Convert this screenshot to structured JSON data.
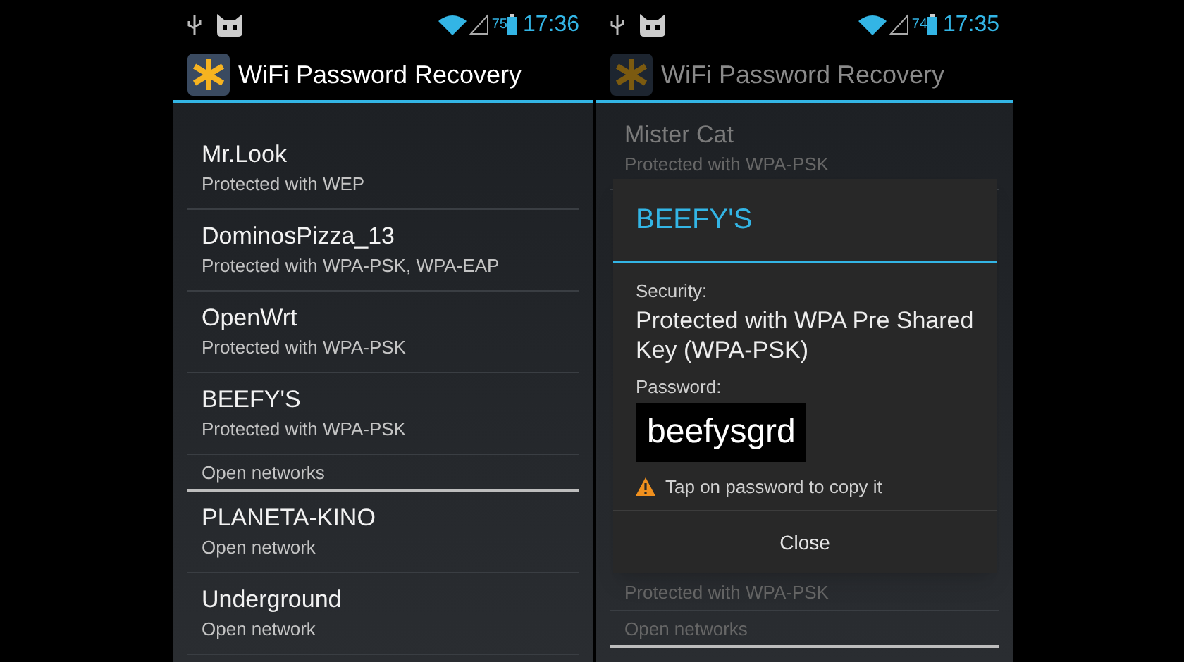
{
  "screens": [
    {
      "status_bar": {
        "battery": "75",
        "time": "17:36"
      },
      "app_bar": {
        "title": "WiFi Password Recovery"
      },
      "dimmed": false,
      "items": [
        {
          "kind": "network",
          "name": "Mr.Look",
          "security": "Protected with WEP"
        },
        {
          "kind": "network",
          "name": "DominosPizza_13",
          "security": "Protected with WPA-PSK, WPA-EAP"
        },
        {
          "kind": "network",
          "name": "OpenWrt",
          "security": "Protected with WPA-PSK"
        },
        {
          "kind": "network",
          "name": "BEEFY'S",
          "security": "Protected with WPA-PSK"
        },
        {
          "kind": "section",
          "label": "Open networks"
        },
        {
          "kind": "network",
          "name": "PLANETA-KINO",
          "security": "Open network"
        },
        {
          "kind": "network",
          "name": "Underground",
          "security": "Open network"
        }
      ]
    },
    {
      "status_bar": {
        "battery": "74",
        "time": "17:35"
      },
      "app_bar": {
        "title": "WiFi Password Recovery"
      },
      "dimmed": true,
      "items": [
        {
          "kind": "network",
          "name": "Mister Cat",
          "security": "Protected with WPA-PSK"
        },
        {
          "kind": "detail",
          "security": "Protected with WPA-PSK"
        },
        {
          "kind": "section",
          "label": "Open networks"
        }
      ],
      "dialog": {
        "title": "BEEFY'S",
        "security_label": "Security:",
        "security_value": "Protected with WPA Pre Shared Key (WPA-PSK)",
        "password_label": "Password:",
        "password": "beefysgrd",
        "hint": "Tap on password to copy it",
        "button": "Close"
      }
    }
  ]
}
